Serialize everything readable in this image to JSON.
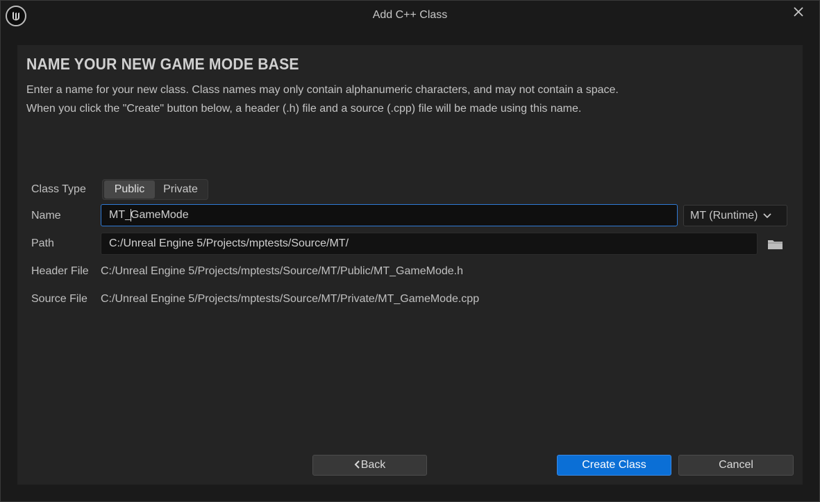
{
  "window": {
    "title": "Add C++ Class",
    "logo_icon": "unreal-logo-icon",
    "close_icon": "close-icon"
  },
  "header": {
    "heading": "NAME YOUR NEW GAME MODE BASE",
    "description_line1": "Enter a name for your new class. Class names may only contain alphanumeric characters, and may not contain a space.",
    "description_line2": "When you click the \"Create\" button below, a header (.h) file and a source (.cpp) file will be made using this name."
  },
  "form": {
    "class_type_label": "Class Type",
    "class_type_options": [
      "Public",
      "Private"
    ],
    "class_type_selected": "Public",
    "name_label": "Name",
    "name_value_before_caret": "MT_",
    "name_value_after_caret": "GameMode",
    "module_value": "MT (Runtime)",
    "path_label": "Path",
    "path_value": "C:/Unreal Engine 5/Projects/mptests/Source/MT/",
    "header_file_label": "Header File",
    "header_file_value": "C:/Unreal Engine 5/Projects/mptests/Source/MT/Public/MT_GameMode.h",
    "source_file_label": "Source File",
    "source_file_value": "C:/Unreal Engine 5/Projects/mptests/Source/MT/Private/MT_GameMode.cpp"
  },
  "footer": {
    "back_label": "Back",
    "create_label": "Create Class",
    "cancel_label": "Cancel"
  },
  "colors": {
    "accent": "#0b6fd6",
    "focus_border": "#2f7ad6",
    "panel": "#242424",
    "window": "#1a1a1a"
  }
}
